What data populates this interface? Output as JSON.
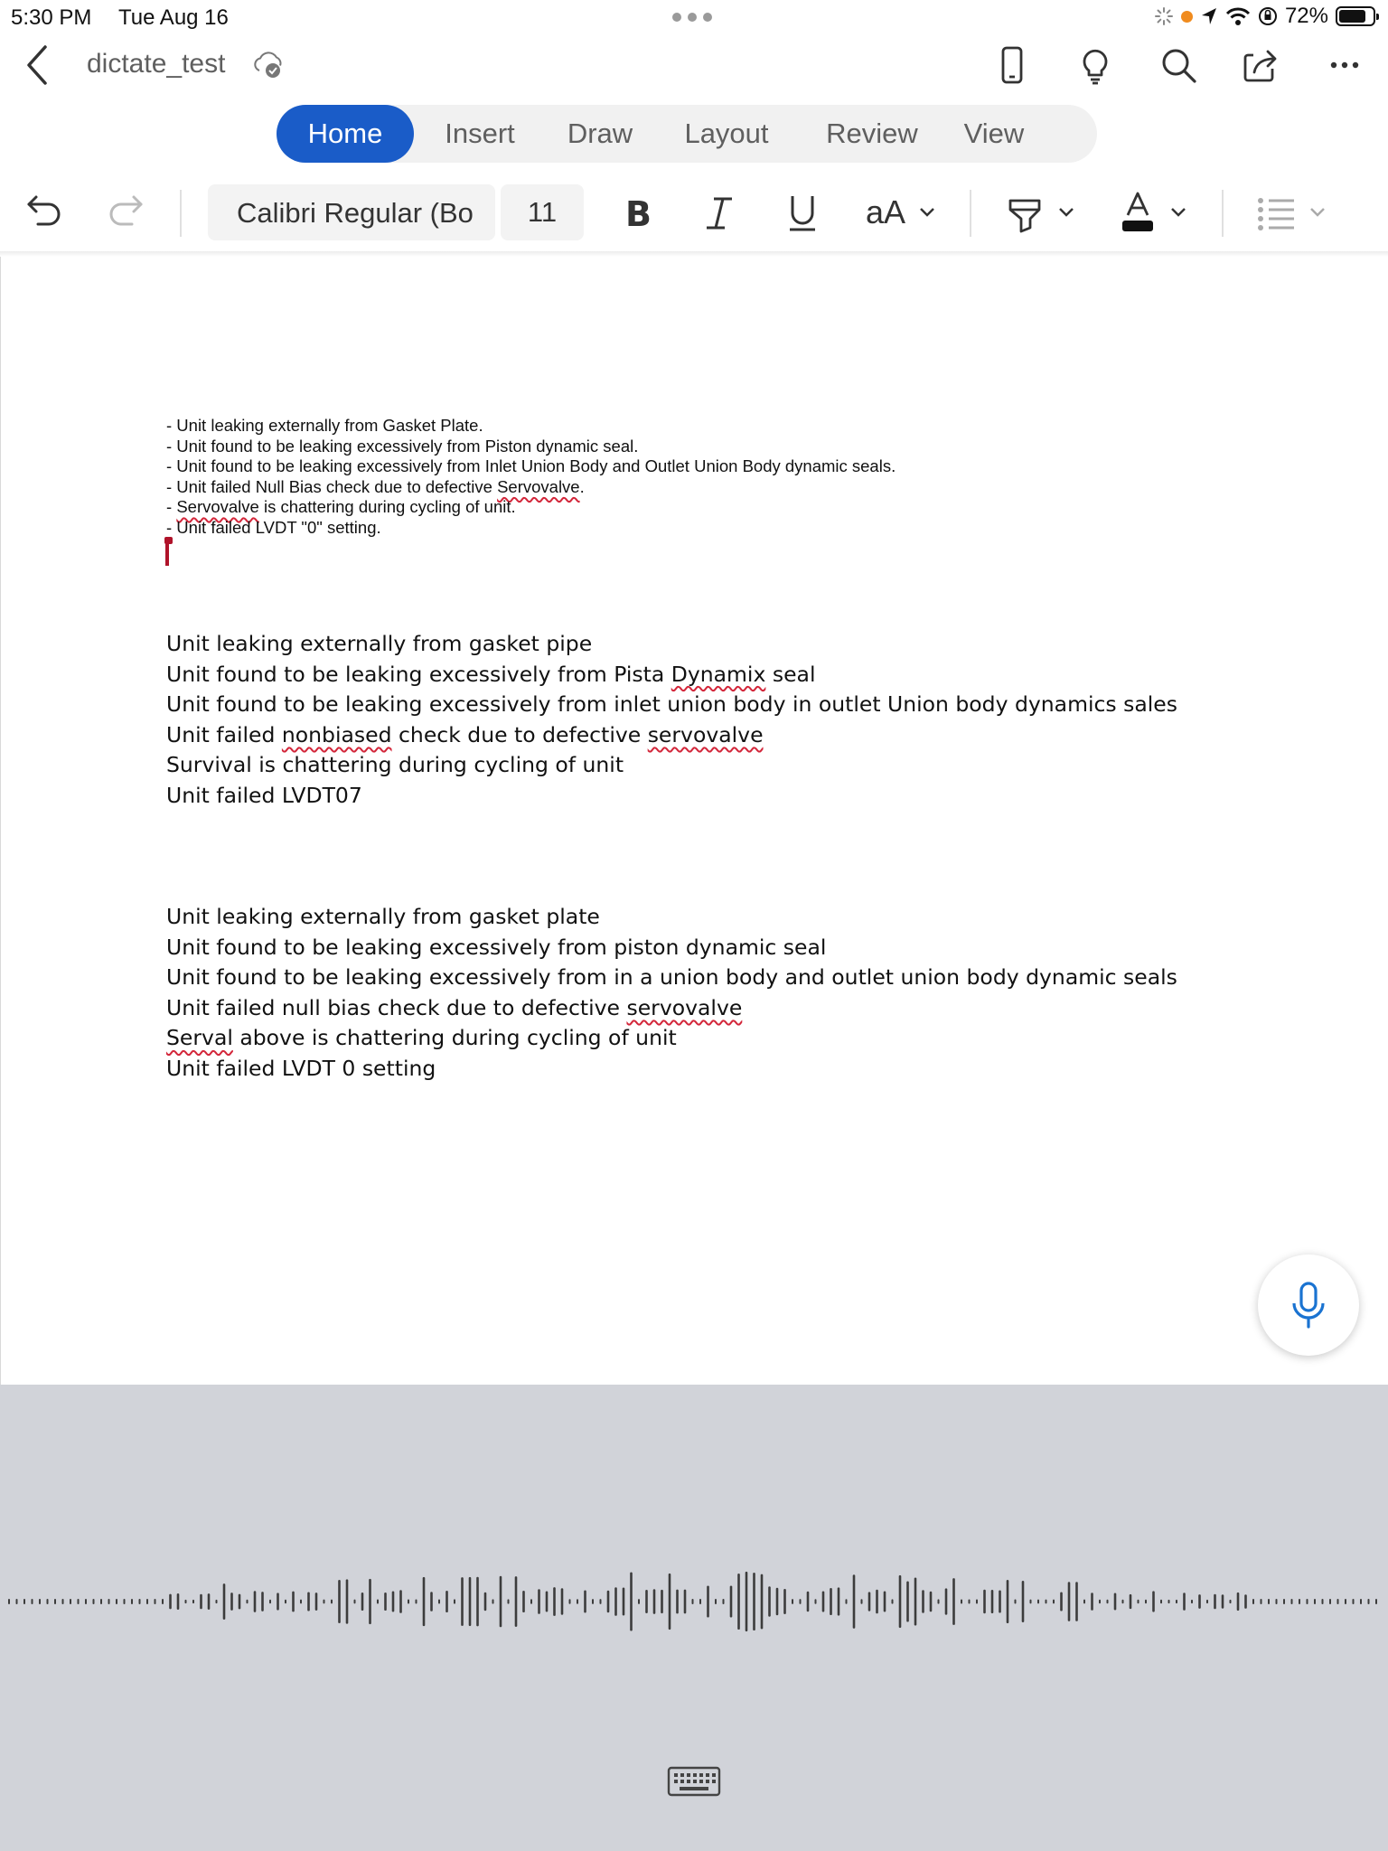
{
  "status_bar": {
    "time": "5:30 PM",
    "date": "Tue Aug 16",
    "battery": "72%"
  },
  "title_bar": {
    "document_name": "dictate_test"
  },
  "tabs": [
    {
      "label": "Home",
      "active": true
    },
    {
      "label": "Insert",
      "active": false
    },
    {
      "label": "Draw",
      "active": false
    },
    {
      "label": "Layout",
      "active": false
    },
    {
      "label": "Review",
      "active": false
    },
    {
      "label": "View",
      "active": false
    }
  ],
  "ribbon": {
    "font_name": "Calibri Regular (Bo",
    "font_size": "11",
    "text_size_label": "aA"
  },
  "document": {
    "block1": [
      "- Unit leaking externally from Gasket Plate.",
      "- Unit found to be leaking excessively from Piston dynamic seal.",
      "- Unit found to be leaking excessively from Inlet Union Body and Outlet Union Body dynamic seals.",
      "- Unit failed Null Bias check due to defective Servovalve.",
      "- Servovalve is chattering during cycling of unit.",
      "- Unit failed LVDT \"0\" setting."
    ],
    "block2": [
      "Unit leaking externally from gasket pipe",
      "Unit found to be leaking excessively from Pista Dynamix seal",
      "Unit found to be leaking excessively from inlet union body in outlet Union body dynamics sales",
      "Unit failed nonbiased check due to defective servovalve",
      "Survival is chattering during cycling of unit",
      "Unit failed LVDT07"
    ],
    "block3": [
      "Unit leaking externally from gasket plate",
      "Unit found to be leaking excessively from piston dynamic seal",
      "Unit found to be leaking excessively from in a union body and outlet union body dynamic seals",
      "Unit failed null bias check due to defective servovalve",
      "Serval above is chattering during cycling of unit",
      "Unit failed LVDT 0 setting"
    ]
  },
  "icons": {
    "back": "chevron-left-icon",
    "cloud": "cloud-sync-icon",
    "device": "phone-view-icon",
    "ideas": "lightbulb-icon",
    "search": "search-icon",
    "share": "share-icon",
    "more": "more-icon",
    "undo": "undo-icon",
    "redo": "redo-icon",
    "mic": "microphone-icon",
    "keyboard": "keyboard-icon"
  },
  "colors": {
    "accent": "#1a5cc8",
    "spellcheck": "#d3263a",
    "cursor": "#b0132a",
    "dictation_panel": "#d1d3d9",
    "mic": "#1a73d1"
  }
}
